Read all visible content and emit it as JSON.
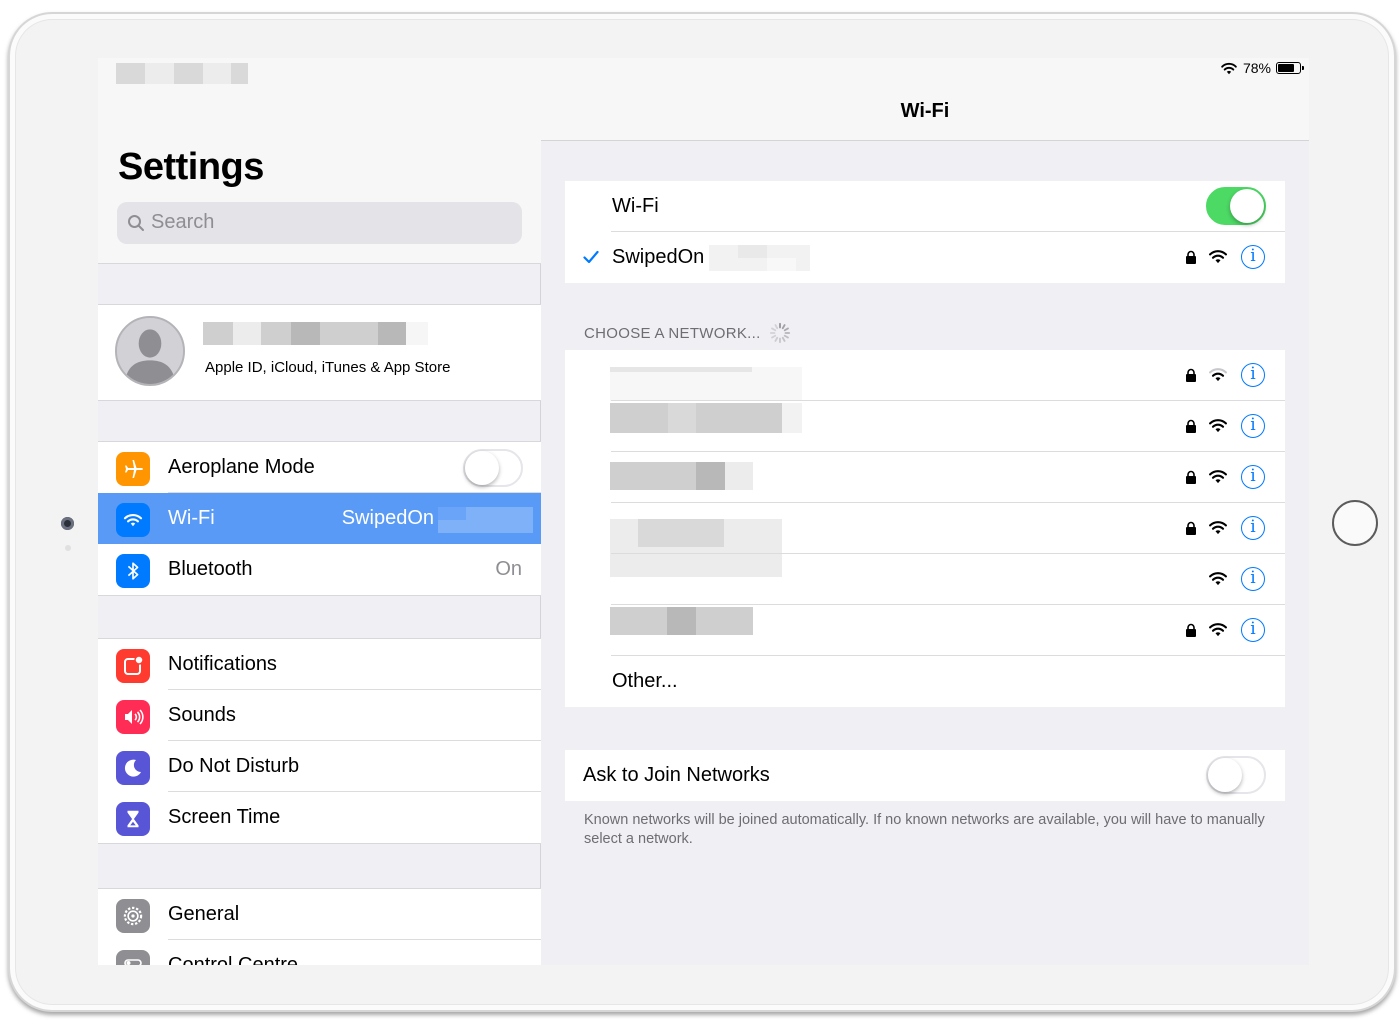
{
  "master": {
    "title": "Settings",
    "search_placeholder": "Search",
    "account": {
      "subtitle": "Apple ID, iCloud, iTunes & App Store"
    },
    "groups": [
      [
        {
          "label": "Aeroplane Mode",
          "icon": "airplane-icon",
          "icon_bg": "#ff9500",
          "toggle": false
        },
        {
          "label": "Wi-Fi",
          "icon": "wifi-icon",
          "icon_bg": "#007aff",
          "value": "SwipedOn",
          "selected": true
        },
        {
          "label": "Bluetooth",
          "icon": "bluetooth-icon",
          "icon_bg": "#007aff",
          "value": "On"
        }
      ],
      [
        {
          "label": "Notifications",
          "icon": "notifications-icon",
          "icon_bg": "#ff3b30"
        },
        {
          "label": "Sounds",
          "icon": "sounds-icon",
          "icon_bg": "#ff2d55"
        },
        {
          "label": "Do Not Disturb",
          "icon": "moon-icon",
          "icon_bg": "#5856d6"
        },
        {
          "label": "Screen Time",
          "icon": "hourglass-icon",
          "icon_bg": "#5856d6"
        }
      ],
      [
        {
          "label": "General",
          "icon": "gear-icon",
          "icon_bg": "#8e8e93"
        },
        {
          "label": "Control Centre",
          "icon": "switches-icon",
          "icon_bg": "#8e8e93"
        }
      ]
    ]
  },
  "status_bar": {
    "battery": "78%",
    "battery_level": 0.78
  },
  "detail": {
    "title": "Wi-Fi",
    "wifi_label": "Wi-Fi",
    "wifi_enabled": true,
    "connected_network": "SwipedOn",
    "choose_header": "CHOOSE A NETWORK...",
    "networks": [
      {
        "secured": true
      },
      {
        "secured": true
      },
      {
        "secured": true
      },
      {
        "secured": true
      },
      {
        "secured": false
      },
      {
        "secured": true
      }
    ],
    "other_label": "Other...",
    "ask_label": "Ask to Join Networks",
    "ask_enabled": false,
    "ask_footnote": "Known networks will be joined automatically. If no known networks are available, you will have to manually select a network.",
    "info_glyph": "i"
  },
  "colors": {
    "accent": "#007aff",
    "selected_row": "#5a9af7",
    "toggle_on": "#4cd964"
  }
}
